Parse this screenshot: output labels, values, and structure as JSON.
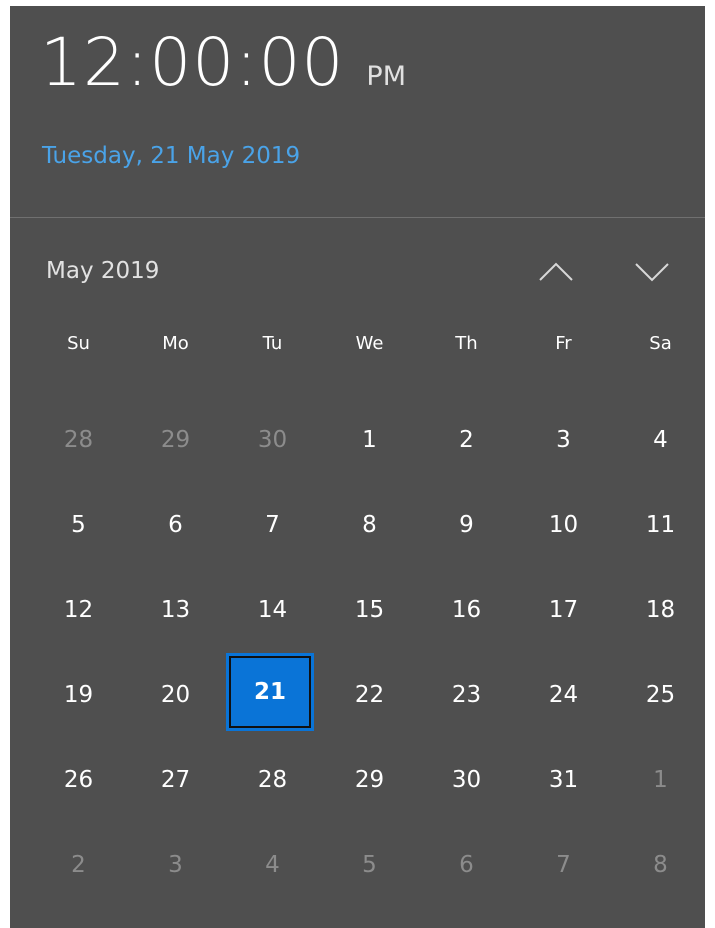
{
  "clock": {
    "time": "12:00:00",
    "ampm": "PM",
    "date": "Tuesday, 21 May 2019"
  },
  "calendar": {
    "month_label": "May 2019",
    "weekdays": [
      "Su",
      "Mo",
      "Tu",
      "We",
      "Th",
      "Fr",
      "Sa"
    ],
    "weeks": [
      [
        {
          "d": "28",
          "other": true
        },
        {
          "d": "29",
          "other": true
        },
        {
          "d": "30",
          "other": true
        },
        {
          "d": "1"
        },
        {
          "d": "2"
        },
        {
          "d": "3"
        },
        {
          "d": "4"
        }
      ],
      [
        {
          "d": "5"
        },
        {
          "d": "6"
        },
        {
          "d": "7"
        },
        {
          "d": "8"
        },
        {
          "d": "9"
        },
        {
          "d": "10"
        },
        {
          "d": "11"
        }
      ],
      [
        {
          "d": "12"
        },
        {
          "d": "13"
        },
        {
          "d": "14"
        },
        {
          "d": "15"
        },
        {
          "d": "16"
        },
        {
          "d": "17"
        },
        {
          "d": "18"
        }
      ],
      [
        {
          "d": "19"
        },
        {
          "d": "20"
        },
        {
          "d": "21",
          "selected": true
        },
        {
          "d": "22"
        },
        {
          "d": "23"
        },
        {
          "d": "24"
        },
        {
          "d": "25"
        }
      ],
      [
        {
          "d": "26"
        },
        {
          "d": "27"
        },
        {
          "d": "28"
        },
        {
          "d": "29"
        },
        {
          "d": "30"
        },
        {
          "d": "31"
        },
        {
          "d": "1",
          "other": true
        }
      ],
      [
        {
          "d": "2",
          "other": true
        },
        {
          "d": "3",
          "other": true
        },
        {
          "d": "4",
          "other": true
        },
        {
          "d": "5",
          "other": true
        },
        {
          "d": "6",
          "other": true
        },
        {
          "d": "7",
          "other": true
        },
        {
          "d": "8",
          "other": true
        }
      ]
    ],
    "nav_icons": {
      "up": "chevron-up-icon",
      "down": "chevron-down-icon"
    }
  },
  "colors": {
    "panel_bg": "#4f4f4f",
    "accent": "#0a74d7",
    "date_link": "#4aa3e8",
    "muted_day": "#8c8c8c"
  }
}
